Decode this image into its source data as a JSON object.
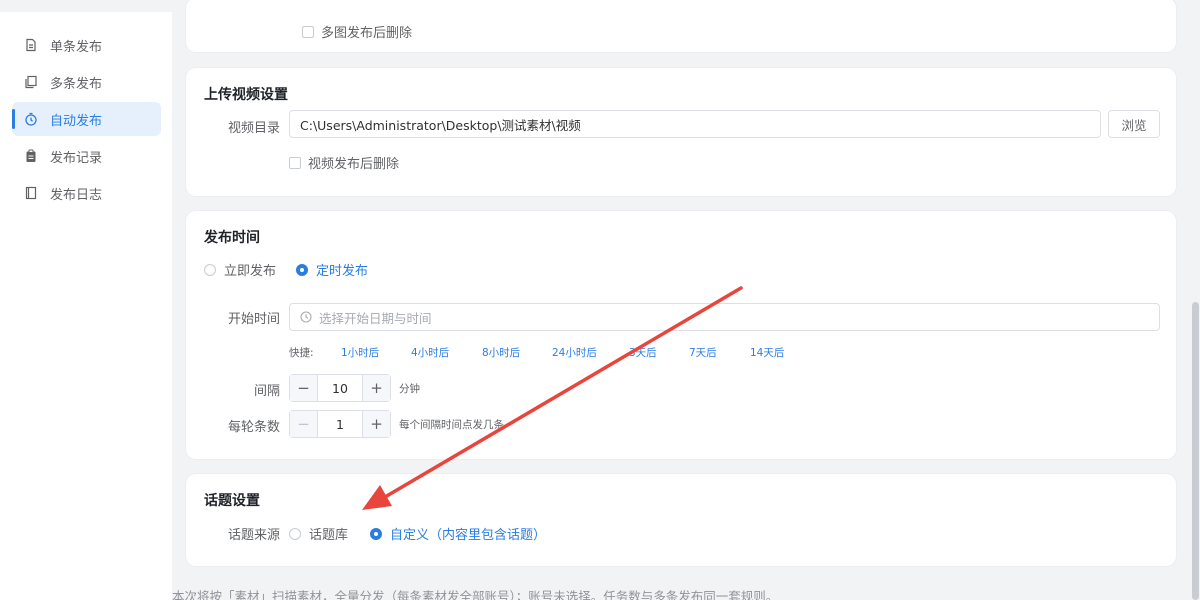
{
  "sidebar": {
    "items": [
      {
        "label": "单条发布",
        "icon": "document-icon"
      },
      {
        "label": "多条发布",
        "icon": "copy-icon"
      },
      {
        "label": "自动发布",
        "icon": "timer-icon",
        "active": true
      },
      {
        "label": "发布记录",
        "icon": "clipboard-icon"
      },
      {
        "label": "发布日志",
        "icon": "book-icon"
      }
    ]
  },
  "image_card": {
    "delete_after_label": "多图发布后删除"
  },
  "video_card": {
    "title": "上传视频设置",
    "dir_label": "视频目录",
    "dir_value": "C:\\Users\\Administrator\\Desktop\\测试素材\\视频",
    "browse_label": "浏览",
    "delete_after_label": "视频发布后删除"
  },
  "time_card": {
    "title": "发布时间",
    "mode_options": [
      {
        "label": "立即发布",
        "checked": false
      },
      {
        "label": "定时发布",
        "checked": true
      }
    ],
    "start_label": "开始时间",
    "start_placeholder": "选择开始日期与时间",
    "quick_label": "快捷:",
    "quick_options": [
      "1小时后",
      "4小时后",
      "8小时后",
      "24小时后",
      "3天后",
      "7天后",
      "14天后"
    ],
    "interval_label": "间隔",
    "interval_value": "10",
    "interval_unit": "分钟",
    "per_round_label": "每轮条数",
    "per_round_value": "1",
    "per_round_hint": "每个间隔时间点发几条"
  },
  "topic_card": {
    "title": "话题设置",
    "source_label": "话题来源",
    "options": [
      {
        "label": "话题库",
        "checked": false
      },
      {
        "label": "自定义（内容里包含话题）",
        "checked": true
      }
    ]
  },
  "footer_note": "本次将按「素材」扫描素材，全量分发（每条素材发全部账号）；账号未选择。任务数与多条发布同一套规则。",
  "colors": {
    "accent": "#2a7de1",
    "annotation_arrow": "#e8453c"
  }
}
